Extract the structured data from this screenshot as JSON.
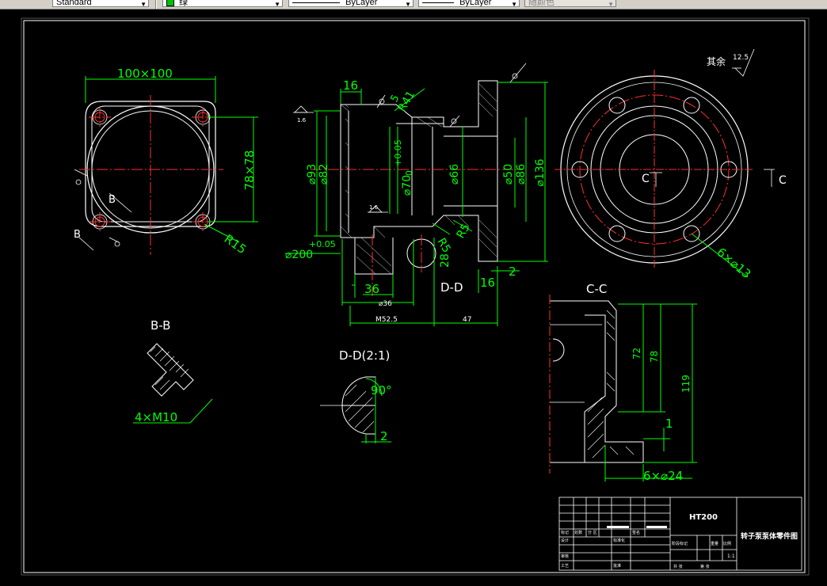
{
  "toolbar": {
    "style_name": "Standard",
    "color_name": "绿",
    "linetype": "ByLayer",
    "lineweight": "ByLayer",
    "plotstyle": "随颜色"
  },
  "drawing": {
    "top_view": {
      "size_label": "100×100",
      "side_label": "78×78",
      "radius_label": "R15",
      "b_label": "B"
    },
    "front": {
      "dim_16_top": "16",
      "rough_5": "5",
      "radius_41": "R41",
      "roughness_16": "1.6",
      "phi93": "⌀93",
      "phi82": "⌀82",
      "tol_plus": "+0.05",
      "tol_zero": "0",
      "phi70": "⌀70",
      "phi66": "⌀66",
      "phi50": "⌀50",
      "phi86": "⌀86",
      "phi136": "⌀136",
      "r5a": "R5",
      "r5b": "R5",
      "dim28": "28",
      "phi200": "⌀200",
      "tol_200": "+0.05",
      "dim36": "36",
      "phi36": "⌀36",
      "m52": "M52.5",
      "dim47": "47",
      "dim16b": "16",
      "dim2": "2",
      "dd_label": "D-D"
    },
    "side_view": {
      "other_rough": "其余",
      "rough_val": "12.5",
      "c_label": "C",
      "holes": "6×⌀13"
    },
    "bb": {
      "title": "B-B",
      "thread": "4×M10"
    },
    "dd": {
      "title": "D-D(2:1)",
      "angle": "90°",
      "dim": "2"
    },
    "cc": {
      "title": "C-C",
      "d72": "72",
      "d78": "78",
      "d119": "119",
      "d1": "1",
      "holes": "6×⌀24"
    },
    "titleblock": {
      "material": "HT200",
      "part_name": "转子泵泵体零件图",
      "scale": "1:1",
      "cells": [
        "标记",
        "处数",
        "分 区",
        "更改文件号",
        "签名",
        "年月日",
        "设计",
        "标准化",
        "阶段标记",
        "重量",
        "比例",
        "审核",
        "工艺",
        "批准",
        "共 张",
        "第 张"
      ]
    }
  }
}
